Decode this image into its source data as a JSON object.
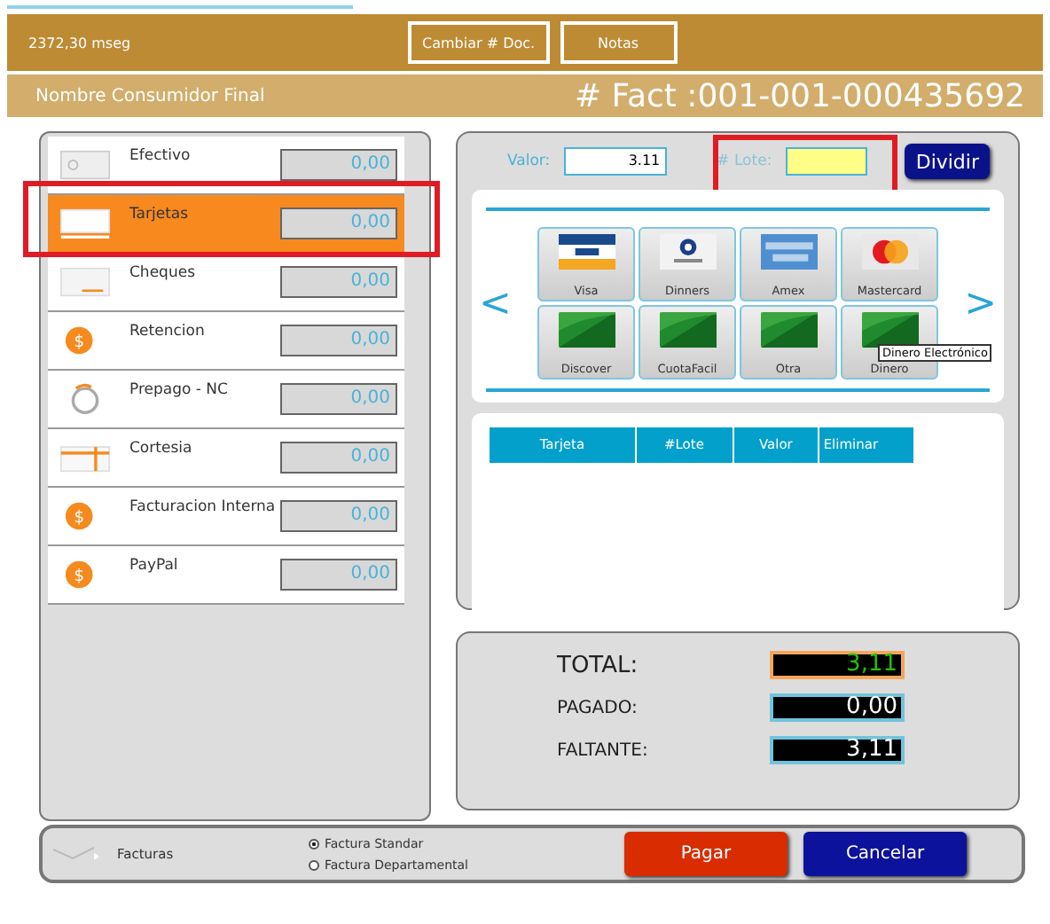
{
  "header": {
    "timing": "2372,30 mseg",
    "buttons": [
      "Cambiar # Doc.",
      "Notas"
    ]
  },
  "subheader": {
    "customer": "Nombre Consumidor Final",
    "invoice": "# Fact :001-001-000435692"
  },
  "payment_methods": [
    {
      "label": "Efectivo",
      "amount": "0,00",
      "kind": "bill",
      "selected": false
    },
    {
      "label": "Tarjetas",
      "amount": "0,00",
      "kind": "card",
      "selected": true
    },
    {
      "label": "Cheques",
      "amount": "0,00",
      "kind": "check",
      "selected": false
    },
    {
      "label": "Retencion",
      "amount": "0,00",
      "kind": "coin",
      "symbol": "$",
      "selected": false
    },
    {
      "label": "Prepago - NC",
      "amount": "0,00",
      "kind": "refund",
      "selected": false
    },
    {
      "label": "Cortesia",
      "amount": "0,00",
      "kind": "gift",
      "selected": false
    },
    {
      "label": "Facturacion Interna",
      "amount": "0,00",
      "kind": "coin",
      "symbol": "$",
      "selected": false
    },
    {
      "label": "PayPal",
      "amount": "0,00",
      "kind": "coin",
      "symbol": "$",
      "selected": false
    }
  ],
  "card_entry": {
    "valor_label": "Valor:",
    "valor": "3.11",
    "lote_label": "# Lote:",
    "split_button": "Dividir"
  },
  "card_types": [
    {
      "label": "Visa",
      "kind": "visa"
    },
    {
      "label": "Dinners",
      "kind": "diners"
    },
    {
      "label": "Amex",
      "kind": "amex"
    },
    {
      "label": "Mastercard",
      "kind": "mastercard"
    },
    {
      "label": "Discover",
      "kind": "generic"
    },
    {
      "label": "CuotaFacil",
      "kind": "generic"
    },
    {
      "label": "Otra",
      "kind": "generic"
    },
    {
      "label": "Dinero",
      "kind": "generic"
    }
  ],
  "carousel": {
    "prev": "<",
    "next": ">"
  },
  "tooltip": "Dinero Electrónico",
  "table": {
    "columns": [
      "Tarjeta",
      "#Lote",
      "Valor",
      "Eliminar"
    ]
  },
  "totals": [
    {
      "label": "TOTAL:",
      "value": "3,11",
      "kind": "total"
    },
    {
      "label": "PAGADO:",
      "value": "0,00",
      "kind": "normal"
    },
    {
      "label": "FALTANTE:",
      "value": "3,11",
      "kind": "normal"
    }
  ],
  "footer": {
    "label": "Facturas",
    "options": [
      {
        "label": "Factura Standar",
        "selected": true
      },
      {
        "label": "Factura Departamental",
        "selected": false
      }
    ],
    "pay": "Pagar",
    "cancel": "Cancelar"
  }
}
